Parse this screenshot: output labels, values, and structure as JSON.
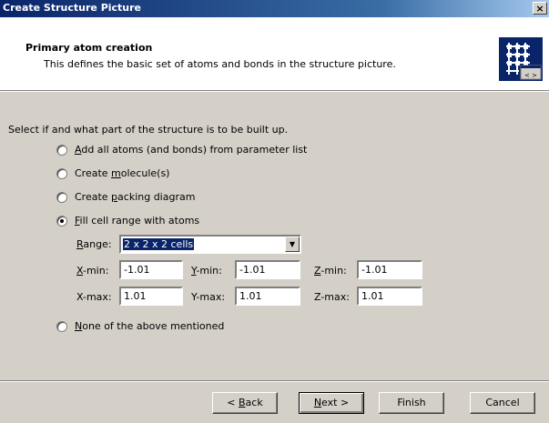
{
  "window": {
    "title": "Create Structure Picture",
    "close_label": "×"
  },
  "header": {
    "title": "Primary atom creation",
    "description": "This defines the basic set of atoms and bonds in the structure picture.",
    "icon": "grid-structure-icon"
  },
  "prompt": "Select if and what part of the structure is to be built up.",
  "options": [
    {
      "pre": "",
      "key": "A",
      "post": "dd all atoms (and bonds) from parameter list",
      "checked": false
    },
    {
      "pre": "Create ",
      "key": "m",
      "post": "olecule(s)",
      "checked": false
    },
    {
      "pre": "Create ",
      "key": "p",
      "post": "acking diagram",
      "checked": false
    },
    {
      "pre": "",
      "key": "F",
      "post": "ill cell range with atoms",
      "checked": true
    },
    {
      "pre": "",
      "key": "N",
      "post": "one of the above mentioned",
      "checked": false
    }
  ],
  "range": {
    "label_key": "R",
    "label_rest": "ange:",
    "value": "2 x 2 x 2 cells"
  },
  "min": {
    "x_key": "X",
    "x_rest": "-min:",
    "x_value": "-1.01",
    "y_key": "Y",
    "y_rest": "-min:",
    "y_value": "-1.01",
    "z_key": "Z",
    "z_rest": "-min:",
    "z_value": "-1.01"
  },
  "max": {
    "x_label": "X-max:",
    "x_value": "1.01",
    "y_label": "Y-max:",
    "y_value": "1.01",
    "z_label": "Z-max:",
    "z_value": "1.01"
  },
  "buttons": {
    "back_pre": "< ",
    "back_key": "B",
    "back_rest": "ack",
    "next_key": "N",
    "next_rest": "ext >",
    "finish": "Finish",
    "cancel": "Cancel"
  },
  "colors": {
    "title_bar": "#0a246a",
    "dialog_face": "#d4d0c8",
    "selection": "#0a246a"
  }
}
